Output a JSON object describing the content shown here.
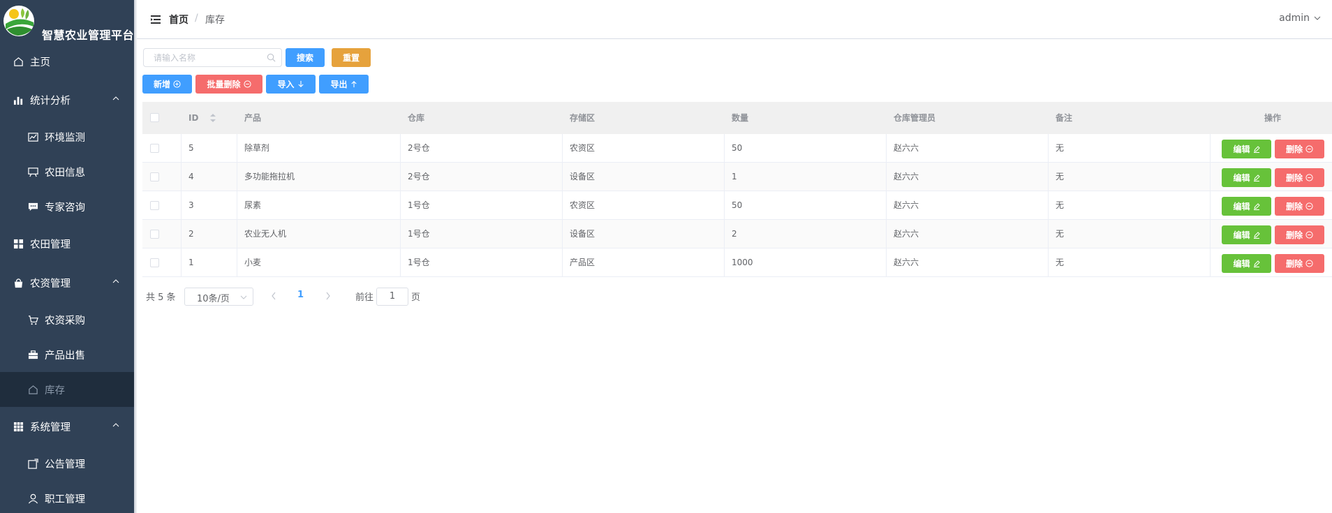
{
  "app": {
    "name": "智慧农业管理平台"
  },
  "sidebar": {
    "items": [
      {
        "label": "主页",
        "icon": "home-icon"
      },
      {
        "label": "统计分析",
        "icon": "bar-chart-icon"
      },
      {
        "label": "环境监测",
        "icon": "line-chart-icon"
      },
      {
        "label": "农田信息",
        "icon": "board-icon"
      },
      {
        "label": "专家咨询",
        "icon": "chat-icon"
      },
      {
        "label": "农田管理",
        "icon": "grid-icon"
      },
      {
        "label": "农资管理",
        "icon": "bag-icon"
      },
      {
        "label": "农资采购",
        "icon": "cart-icon"
      },
      {
        "label": "产品出售",
        "icon": "briefcase-icon"
      },
      {
        "label": "库存",
        "icon": "home-icon"
      },
      {
        "label": "系统管理",
        "icon": "apps-icon"
      },
      {
        "label": "公告管理",
        "icon": "notice-icon"
      },
      {
        "label": "职工管理",
        "icon": "user-icon"
      }
    ]
  },
  "header": {
    "breadcrumb_home": "首页",
    "breadcrumb_sep": "/",
    "breadcrumb_current": "库存",
    "user": "admin"
  },
  "toolbar": {
    "search_placeholder": "请输入名称",
    "search_label": "搜索",
    "reset_label": "重置",
    "add_label": "新增",
    "batch_delete_label": "批量删除",
    "import_label": "导入",
    "export_label": "导出"
  },
  "table": {
    "columns": [
      "ID",
      "产品",
      "仓库",
      "存储区",
      "数量",
      "仓库管理员",
      "备注",
      "操作"
    ],
    "rows": [
      {
        "id": "5",
        "product": "除草剂",
        "warehouse": "2号仓",
        "area": "农资区",
        "quantity": "50",
        "keeper": "赵六六",
        "note": "无"
      },
      {
        "id": "4",
        "product": "多功能拖拉机",
        "warehouse": "2号仓",
        "area": "设备区",
        "quantity": "1",
        "keeper": "赵六六",
        "note": "无"
      },
      {
        "id": "3",
        "product": "尿素",
        "warehouse": "1号仓",
        "area": "农资区",
        "quantity": "50",
        "keeper": "赵六六",
        "note": "无"
      },
      {
        "id": "2",
        "product": "农业无人机",
        "warehouse": "1号仓",
        "area": "设备区",
        "quantity": "2",
        "keeper": "赵六六",
        "note": "无"
      },
      {
        "id": "1",
        "product": "小麦",
        "warehouse": "1号仓",
        "area": "产品区",
        "quantity": "1000",
        "keeper": "赵六六",
        "note": "无"
      }
    ],
    "edit_label": "编辑",
    "delete_label": "删除"
  },
  "pagination": {
    "total": "共 5 条",
    "page_size": "10条/页",
    "current_page": "1",
    "goto_prefix": "前往",
    "goto_value": "1",
    "goto_suffix": "页"
  },
  "colors": {
    "sidebar_bg": "#304156",
    "primary": "#409eff",
    "warning": "#e6a23c",
    "danger": "#f56c6c",
    "success": "#67c23a"
  }
}
